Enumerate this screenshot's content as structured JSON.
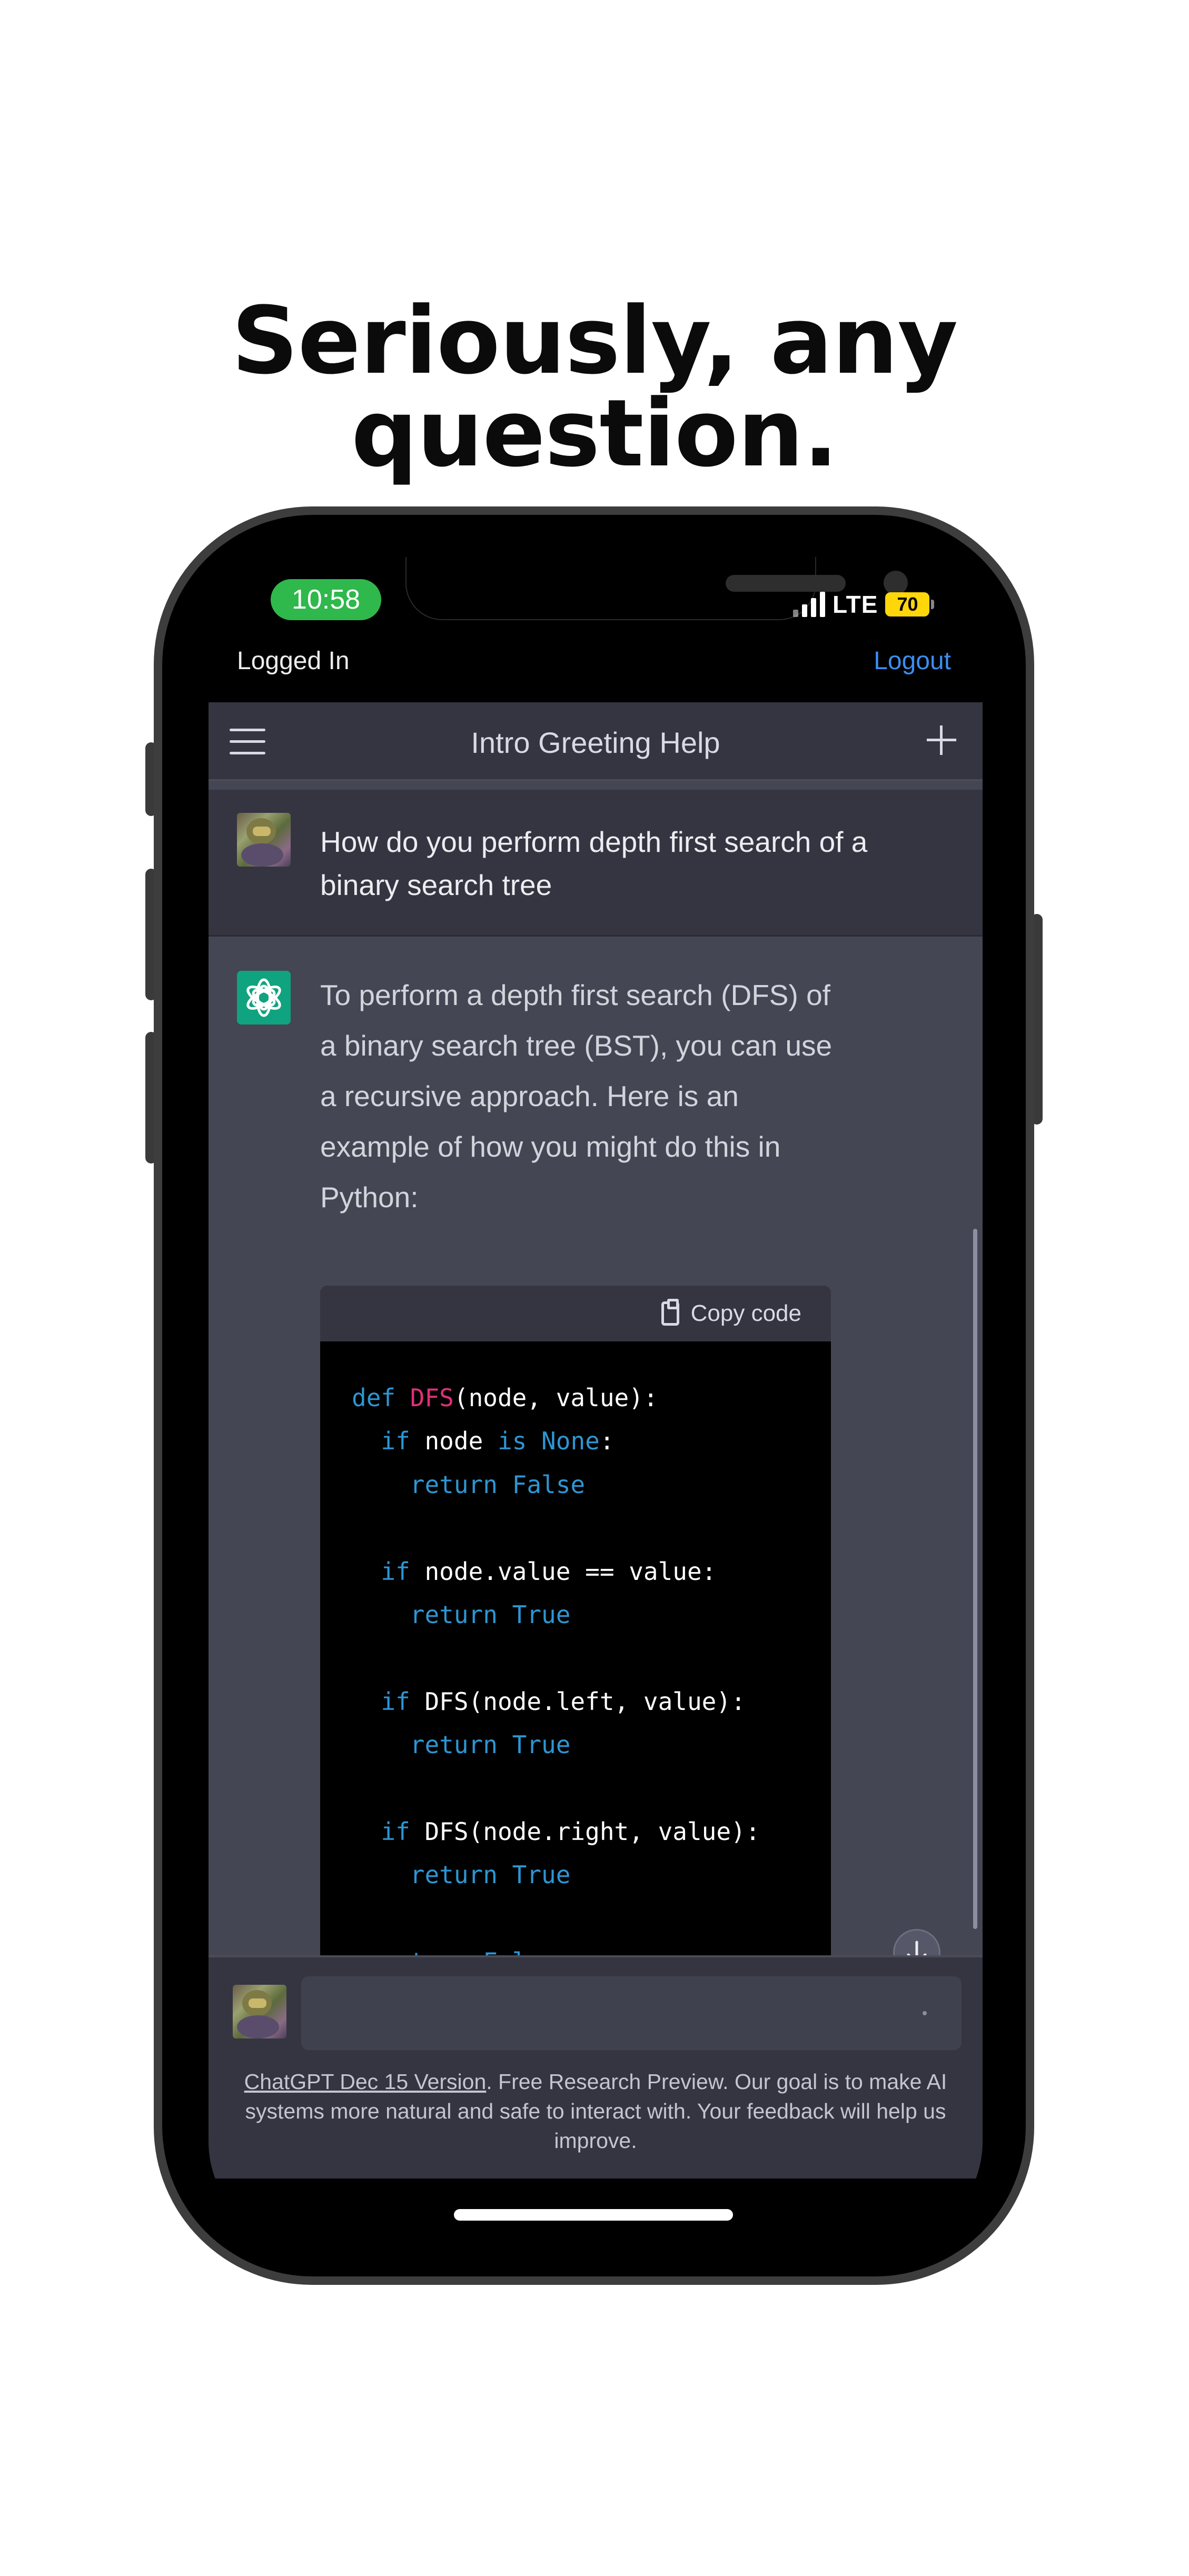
{
  "headline": "Seriously, any question.",
  "status_bar": {
    "time": "10:58",
    "network": "LTE",
    "battery": "70"
  },
  "session": {
    "logged_in_label": "Logged In",
    "logout_label": "Logout"
  },
  "chat_header": {
    "title": "Intro Greeting Help"
  },
  "user_message": {
    "text": "How do you perform depth first search of a binary search tree"
  },
  "assistant_message": {
    "text": "To perform a depth first search (DFS) of a binary search tree (BST), you can use a recursive approach. Here is an example of how you might do this in Python:"
  },
  "code_block": {
    "copy_label": "Copy code",
    "lines": [
      {
        "indent": "",
        "tokens": [
          {
            "t": "def ",
            "c": "kw"
          },
          {
            "t": "DFS",
            "c": "fn"
          },
          {
            "t": "(node, value):",
            "c": ""
          }
        ]
      },
      {
        "indent": "  ",
        "tokens": [
          {
            "t": "if ",
            "c": "kw"
          },
          {
            "t": "node ",
            "c": ""
          },
          {
            "t": "is None",
            "c": "kw"
          },
          {
            "t": ":",
            "c": ""
          }
        ]
      },
      {
        "indent": "    ",
        "tokens": [
          {
            "t": "return False",
            "c": "kw"
          }
        ]
      },
      {
        "indent": "",
        "tokens": []
      },
      {
        "indent": "  ",
        "tokens": [
          {
            "t": "if ",
            "c": "kw"
          },
          {
            "t": "node.value == value:",
            "c": ""
          }
        ]
      },
      {
        "indent": "    ",
        "tokens": [
          {
            "t": "return True",
            "c": "kw"
          }
        ]
      },
      {
        "indent": "",
        "tokens": []
      },
      {
        "indent": "  ",
        "tokens": [
          {
            "t": "if ",
            "c": "kw"
          },
          {
            "t": "DFS(node.left, value):",
            "c": ""
          }
        ]
      },
      {
        "indent": "    ",
        "tokens": [
          {
            "t": "return True",
            "c": "kw"
          }
        ]
      },
      {
        "indent": "",
        "tokens": []
      },
      {
        "indent": "  ",
        "tokens": [
          {
            "t": "if ",
            "c": "kw"
          },
          {
            "t": "DFS(node.right, value):",
            "c": ""
          }
        ]
      },
      {
        "indent": "    ",
        "tokens": [
          {
            "t": "return True",
            "c": "kw"
          }
        ]
      },
      {
        "indent": "",
        "tokens": []
      },
      {
        "indent": "  ",
        "tokens": [
          {
            "t": "return False",
            "c": "kw"
          }
        ]
      }
    ]
  },
  "composer": {
    "placeholder": ""
  },
  "footer": {
    "link": "ChatGPT Dec 15 Version",
    "text": ". Free Research Preview. Our goal is to make AI systems more natural and safe to interact with. Your feedback will help us improve."
  },
  "icons": {
    "menu": "hamburger-icon",
    "new_chat": "plus-icon",
    "copy": "clipboard-icon",
    "scroll_down": "arrow-down-icon",
    "assistant_avatar": "openai-logo-icon"
  },
  "colors": {
    "accent_link": "#3b8ef0",
    "time_pill": "#2fb84c",
    "battery": "#ffd60a",
    "assistant_logo": "#10a37f",
    "code_keyword": "#2e95d3",
    "code_function": "#df3079"
  }
}
